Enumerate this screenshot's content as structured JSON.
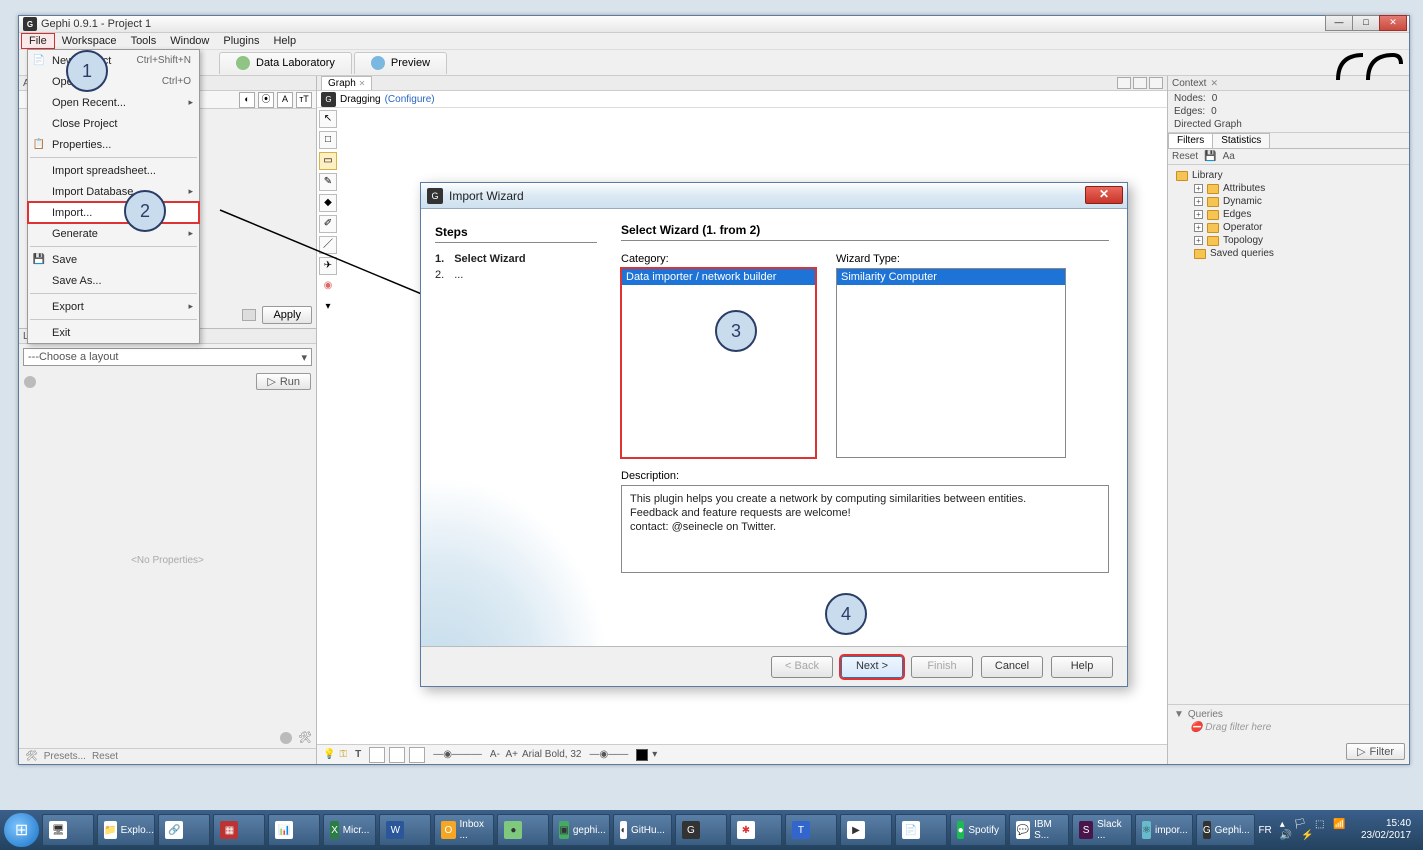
{
  "window": {
    "title": "Gephi 0.9.1 - Project 1"
  },
  "menubar": [
    "File",
    "Workspace",
    "Tools",
    "Window",
    "Plugins",
    "Help"
  ],
  "file_menu": {
    "new_project": "New Project",
    "new_shortcut": "Ctrl+Shift+N",
    "open": "Open...",
    "open_shortcut": "Ctrl+O",
    "open_recent": "Open Recent...",
    "close": "Close Project",
    "properties": "Properties...",
    "import_spreadsheet": "Import spreadsheet...",
    "import_db": "Import Database",
    "import": "Import...",
    "generate": "Generate",
    "save": "Save",
    "save_as": "Save As...",
    "export": "Export",
    "exit": "Exit"
  },
  "ws_tabs": {
    "data": "Data Laboratory",
    "preview": "Preview"
  },
  "left": {
    "appearance": "Appearance",
    "apply": "Apply",
    "layout": "Layout",
    "choose": "---Choose a layout",
    "run": "Run",
    "noprops": "<No Properties>",
    "presets": "Presets...",
    "reset": "Reset"
  },
  "graph": {
    "tab": "Graph",
    "dragging": "Dragging",
    "configure": "(Configure)",
    "font": "Arial Bold, 32"
  },
  "context": {
    "title": "Context",
    "nodes_l": "Nodes:",
    "nodes_v": "0",
    "edges_l": "Edges:",
    "edges_v": "0",
    "dg": "Directed Graph"
  },
  "filters_panel": {
    "filters": "Filters",
    "stats": "Statistics",
    "reset": "Reset",
    "library": "Library",
    "items": [
      "Attributes",
      "Dynamic",
      "Edges",
      "Operator",
      "Topology",
      "Saved queries"
    ],
    "queries": "Queries",
    "drag": "Drag filter here",
    "filter_btn": "Filter"
  },
  "wizard": {
    "title": "Import Wizard",
    "steps_h": "Steps",
    "step1_n": "1.",
    "step1": "Select Wizard",
    "step2_n": "2.",
    "step2": "...",
    "main_h": "Select Wizard (1. from 2)",
    "cat_l": "Category:",
    "cat_item": "Data importer / network builder",
    "wiz_l": "Wizard Type:",
    "wiz_item": "Similarity Computer",
    "desc_l": "Description:",
    "desc": "This plugin helps you create a network by computing similarities between entities.\nFeedback and feature requests are welcome!\ncontact: @seinecle on Twitter.",
    "back": "< Back",
    "next": "Next >",
    "finish": "Finish",
    "cancel": "Cancel",
    "help": "Help"
  },
  "annotations": {
    "a1": "1",
    "a2": "2",
    "a3": "3",
    "a4": "4"
  },
  "taskbar": {
    "items": [
      "",
      "",
      "Explo...",
      "",
      "",
      "",
      "Micr...",
      "",
      "Inbox ...",
      "",
      "gephi...",
      "GitHu...",
      "",
      "",
      "",
      "",
      "",
      "Spotify",
      "IBM S...",
      "Slack ...",
      "impor...",
      "Gephi..."
    ],
    "lang": "FR",
    "time": "15:40",
    "date": "23/02/2017"
  }
}
